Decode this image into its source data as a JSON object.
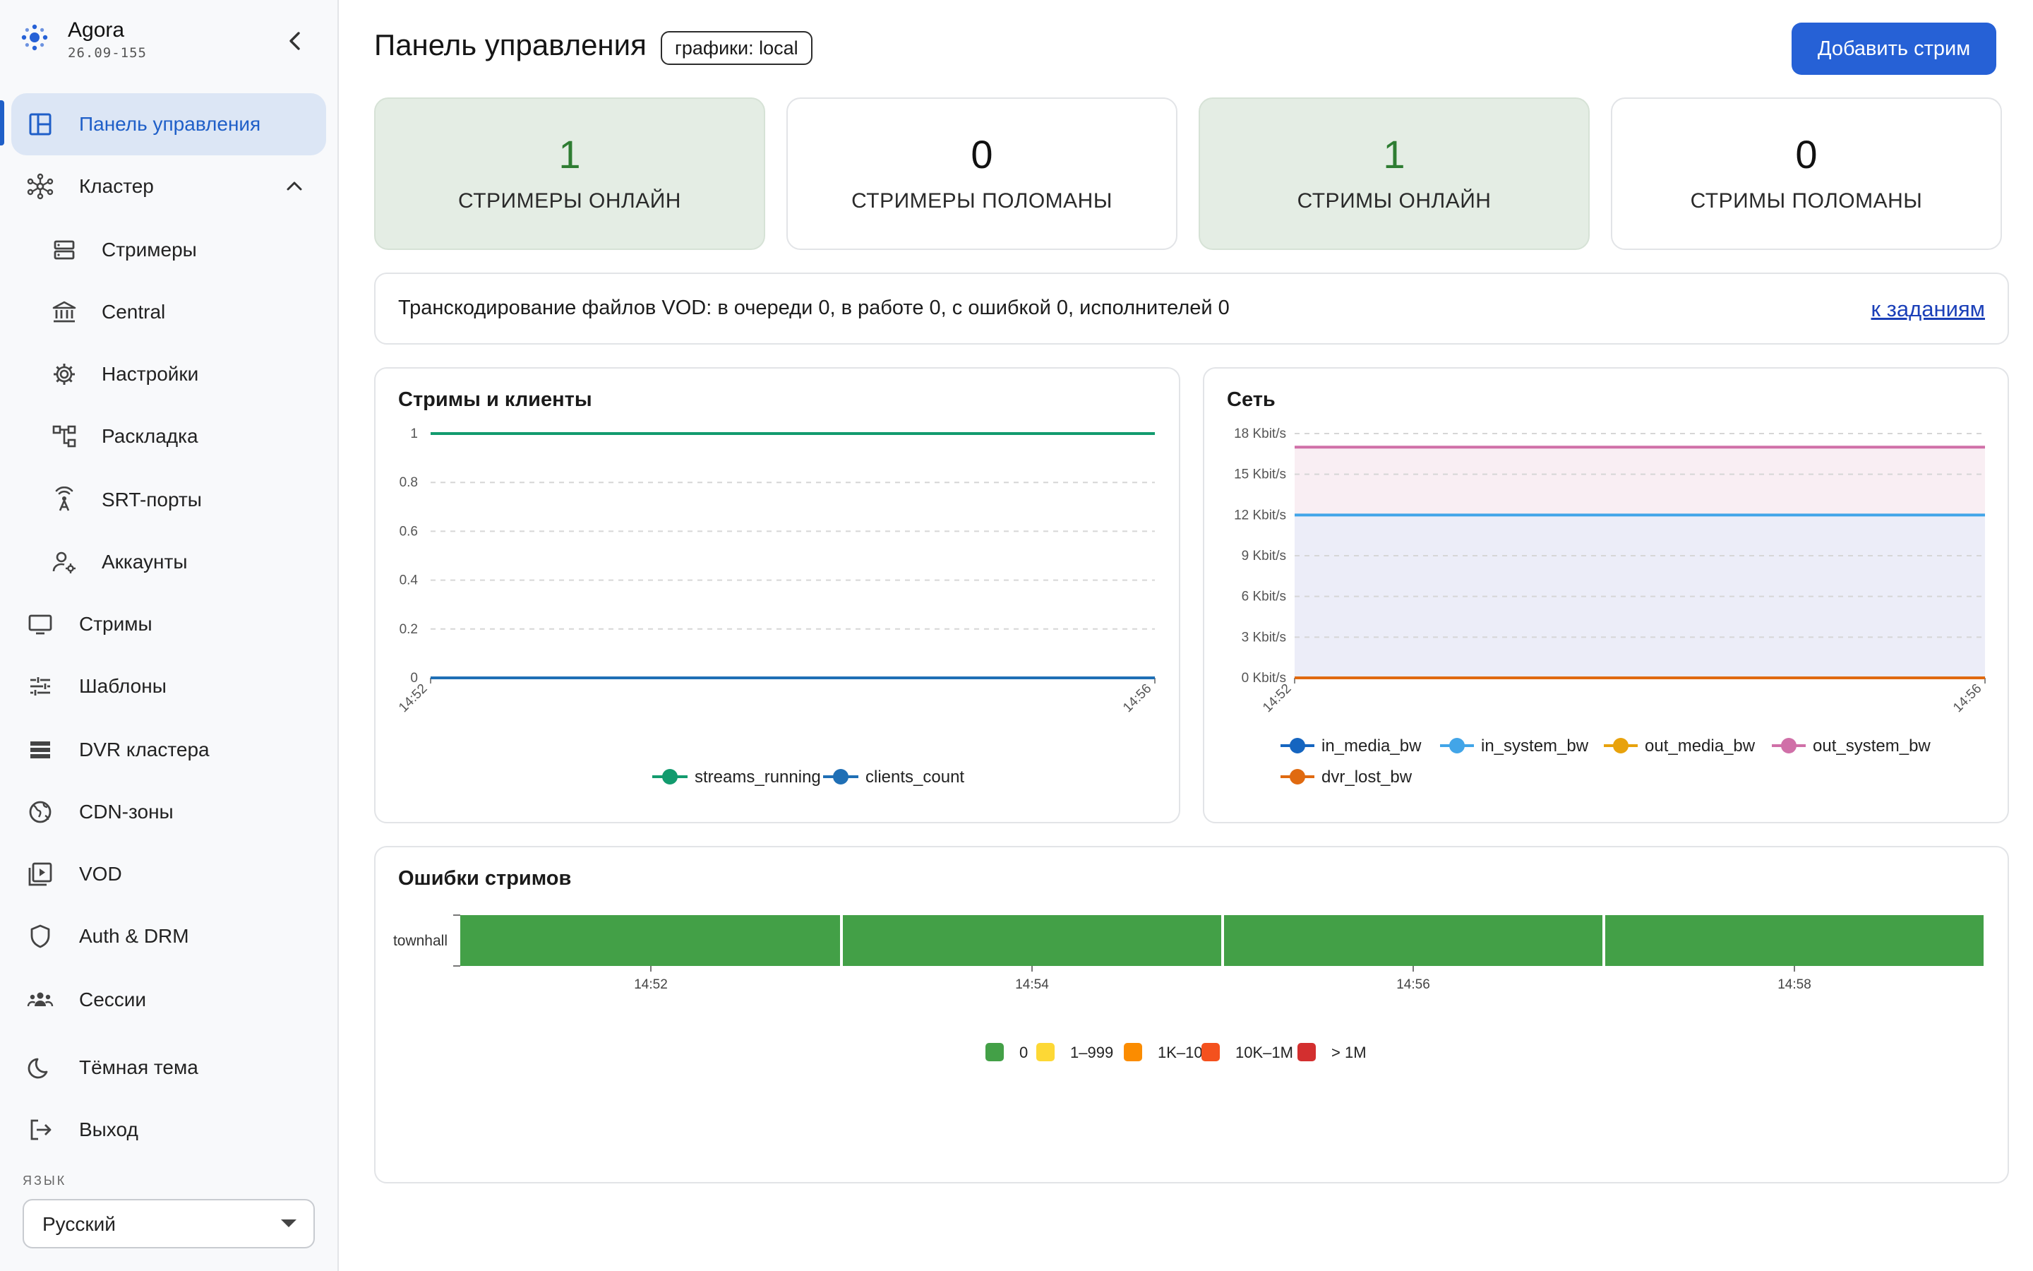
{
  "app": {
    "name": "Agora",
    "version": "26.09-155"
  },
  "sidebar": {
    "items": [
      {
        "key": "dashboard",
        "label": "Панель управления",
        "icon": "dashboard-icon",
        "active": true
      },
      {
        "key": "cluster",
        "label": "Кластер",
        "icon": "cluster-icon"
      },
      {
        "key": "streamers",
        "label": "Стримеры",
        "icon": "server-icon",
        "sub": true
      },
      {
        "key": "central",
        "label": "Central",
        "icon": "bank-icon",
        "sub": true
      },
      {
        "key": "settings",
        "label": "Настройки",
        "icon": "gear-icon",
        "sub": true
      },
      {
        "key": "layout",
        "label": "Раскладка",
        "icon": "layout-tree-icon",
        "sub": true
      },
      {
        "key": "srt",
        "label": "SRT-порты",
        "icon": "antenna-icon",
        "sub": true
      },
      {
        "key": "accounts",
        "label": "Аккаунты",
        "icon": "account-gear-icon",
        "sub": true
      },
      {
        "key": "streams",
        "label": "Стримы",
        "icon": "monitor-icon"
      },
      {
        "key": "templates",
        "label": "Шаблоны",
        "icon": "sliders-icon"
      },
      {
        "key": "dvr",
        "label": "DVR кластера",
        "icon": "storage-icon"
      },
      {
        "key": "cdn",
        "label": "CDN-зоны",
        "icon": "globe-icon"
      },
      {
        "key": "vod",
        "label": "VOD",
        "icon": "video-library-icon"
      },
      {
        "key": "auth",
        "label": "Auth & DRM",
        "icon": "shield-icon"
      },
      {
        "key": "sessions",
        "label": "Сессии",
        "icon": "people-icon"
      },
      {
        "key": "dark",
        "label": "Тёмная тема",
        "icon": "moon-icon"
      },
      {
        "key": "logout",
        "label": "Выход",
        "icon": "logout-icon"
      }
    ],
    "language_label": "ЯЗЫК",
    "language_value": "Русский"
  },
  "header": {
    "title": "Панель управления",
    "badge": "графики: local",
    "add_button": "Добавить стрим"
  },
  "stats": [
    {
      "value": "1",
      "caption": "СТРИМЕРЫ ОНЛАЙН",
      "ok": true
    },
    {
      "value": "0",
      "caption": "СТРИМЕРЫ ПОЛОМАНЫ",
      "ok": false
    },
    {
      "value": "1",
      "caption": "СТРИМЫ ОНЛАЙН",
      "ok": true
    },
    {
      "value": "0",
      "caption": "СТРИМЫ ПОЛОМАНЫ",
      "ok": false
    }
  ],
  "vod": {
    "text": "Транскодирование файлов VOD: в очереди 0, в работе 0, с ошибкой 0, исполнителей 0",
    "link": "к заданиям"
  },
  "panels": {
    "streams_title": "Стримы и клиенты",
    "network_title": "Сеть",
    "errors_title": "Ошибки стримов"
  },
  "colors": {
    "accent": "#2661d6",
    "ok_green": "#2e7d32",
    "error_bar": "#43a047"
  },
  "chart_data": [
    {
      "type": "line",
      "title": "Стримы и клиенты",
      "x": [
        "14:52",
        "14:56"
      ],
      "ylim": [
        0,
        1
      ],
      "yticks": [
        "0",
        "0.2",
        "0.4",
        "0.6",
        "0.8",
        "1"
      ],
      "series": [
        {
          "name": "streams_running",
          "color": "#129b6e",
          "values": [
            1,
            1
          ]
        },
        {
          "name": "clients_count",
          "color": "#1f6fb5",
          "values": [
            0,
            0
          ]
        }
      ],
      "legend": "bottom"
    },
    {
      "type": "area",
      "title": "Сеть",
      "x": [
        "14:52",
        "14:56"
      ],
      "ylim": [
        0,
        18
      ],
      "yticks": [
        "0 Kbit/s",
        "3 Kbit/s",
        "6 Kbit/s",
        "9 Kbit/s",
        "12 Kbit/s",
        "15 Kbit/s",
        "18 Kbit/s"
      ],
      "series": [
        {
          "name": "in_media_bw",
          "color": "#1565c0",
          "values": [
            0,
            0
          ]
        },
        {
          "name": "in_system_bw",
          "color": "#42a5e8",
          "values": [
            12,
            12
          ]
        },
        {
          "name": "out_media_bw",
          "color": "#e8a20c",
          "values": [
            0,
            0
          ]
        },
        {
          "name": "out_system_bw",
          "color": "#d070a8",
          "values": [
            17,
            17
          ]
        },
        {
          "name": "dvr_lost_bw",
          "color": "#e06a10",
          "values": [
            0,
            0
          ]
        }
      ],
      "legend": "bottom"
    },
    {
      "type": "heatmap",
      "title": "Ошибки стримов",
      "rows": [
        "townhall"
      ],
      "x_ticks": [
        "14:52",
        "14:54",
        "14:56",
        "14:58"
      ],
      "segments": 4,
      "values": [
        0,
        0,
        0,
        0
      ],
      "legend": [
        {
          "label": "0",
          "color": "#43a047"
        },
        {
          "label": "1–999",
          "color": "#fdd835"
        },
        {
          "label": "1K–10K",
          "color": "#fb8c00"
        },
        {
          "label": "10K–1M",
          "color": "#f4511e"
        },
        {
          "label": "> 1M",
          "color": "#d32f2f"
        }
      ]
    }
  ]
}
